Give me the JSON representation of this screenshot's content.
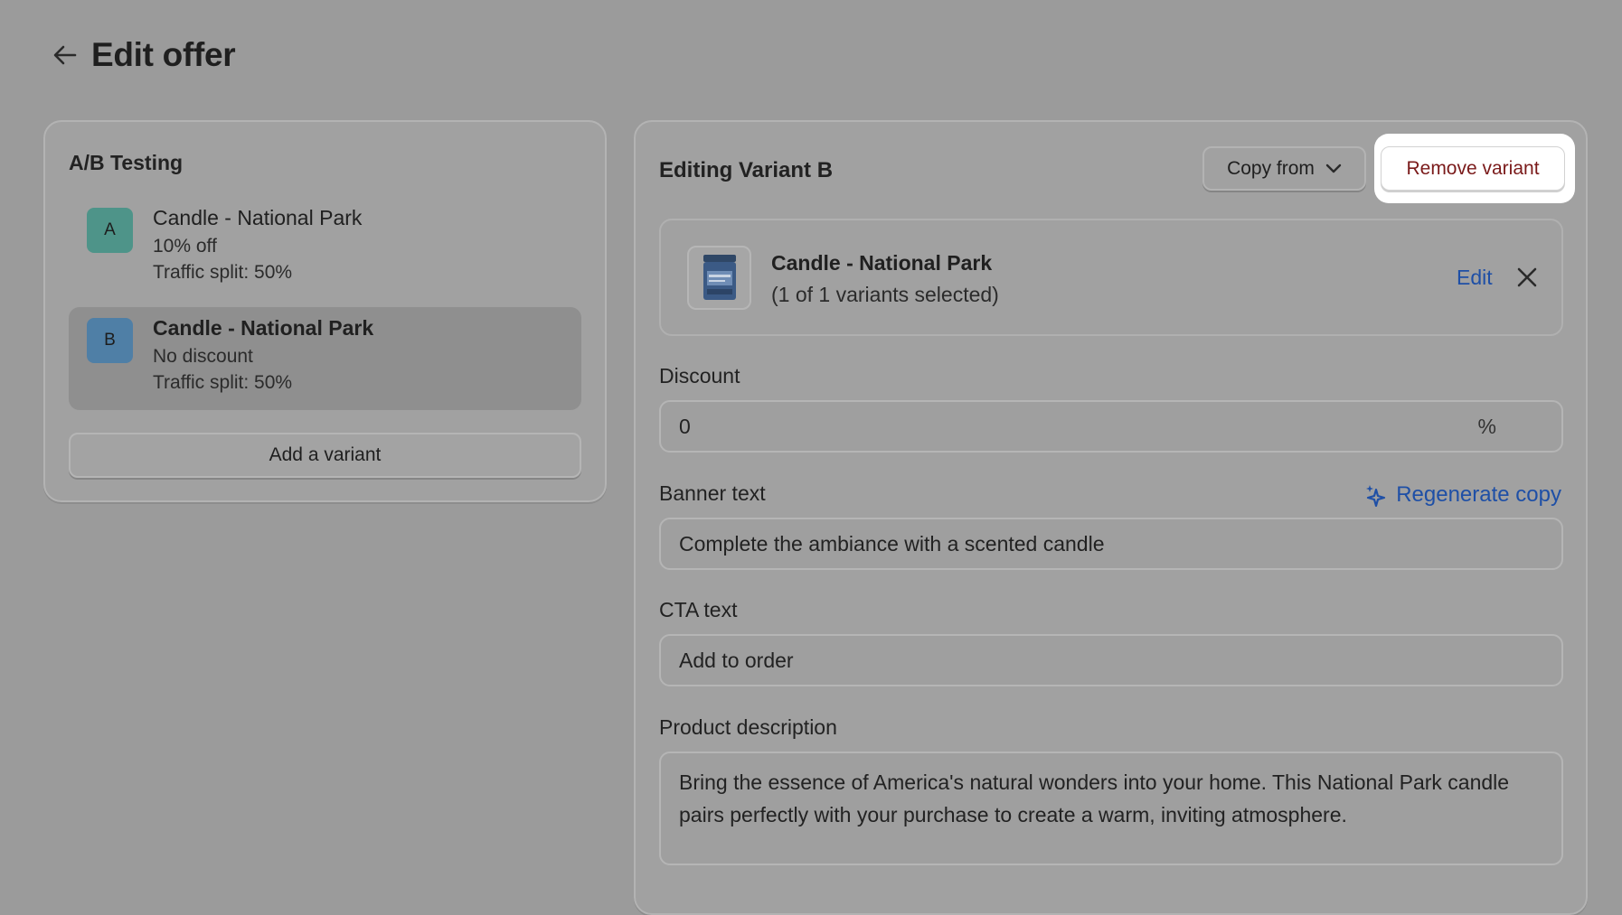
{
  "header": {
    "title": "Edit offer"
  },
  "ab_testing": {
    "title": "A/B Testing",
    "variants": [
      {
        "badge": "A",
        "name": "Candle - National Park",
        "discount": "10% off",
        "split": "Traffic split: 50%"
      },
      {
        "badge": "B",
        "name": "Candle - National Park",
        "discount": "No discount",
        "split": "Traffic split: 50%"
      }
    ],
    "add_label": "Add a variant"
  },
  "editor": {
    "title": "Editing Variant B",
    "copy_from_label": "Copy from",
    "remove_label": "Remove variant",
    "product": {
      "name": "Candle - National Park",
      "selection": "(1 of 1 variants selected)",
      "edit_label": "Edit"
    },
    "discount": {
      "label": "Discount",
      "value": "0",
      "suffix": "%"
    },
    "banner": {
      "label": "Banner text",
      "regenerate_label": "Regenerate copy",
      "value": "Complete the ambiance with a scented candle"
    },
    "cta": {
      "label": "CTA text",
      "value": "Add to order"
    },
    "description": {
      "label": "Product description",
      "value": "Bring the essence of America's natural wonders into your home. This National Park candle pairs perfectly with your purchase to create a warm, inviting atmosphere."
    }
  },
  "colors": {
    "link": "#1e4fa6",
    "badge_a": "#4e9489",
    "badge_b": "#4f7fa6",
    "remove_text": "#7a1a1a"
  }
}
